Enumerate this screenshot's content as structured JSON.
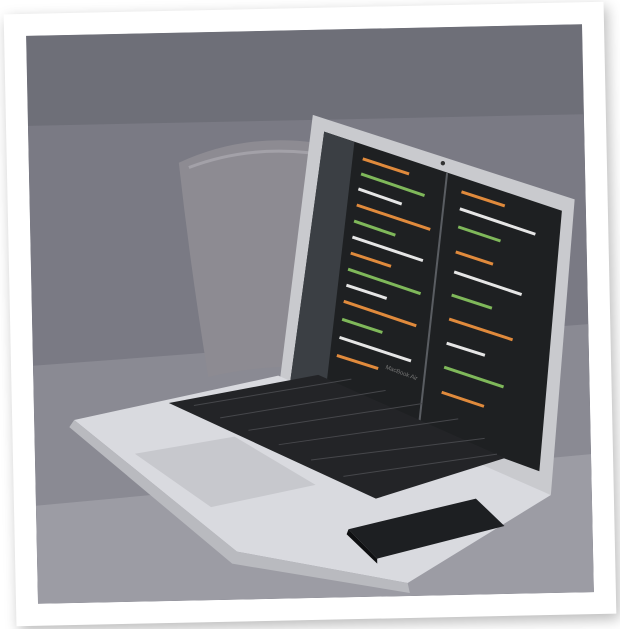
{
  "photo": {
    "subject": "laptop-on-couch",
    "laptop_label": "MacBook Air",
    "colors": {
      "couch": "#7d7c85",
      "couch_light": "#9e9ea6",
      "pillow": "#8e8c92",
      "laptop_body": "#d9dadf",
      "screen_bg": "#1e2022",
      "sidebar": "#3b3f44",
      "code_orange": "#e08a3c",
      "code_green": "#7fb85a",
      "code_white": "#e6e6e6",
      "phone": "#1d1f22"
    }
  }
}
